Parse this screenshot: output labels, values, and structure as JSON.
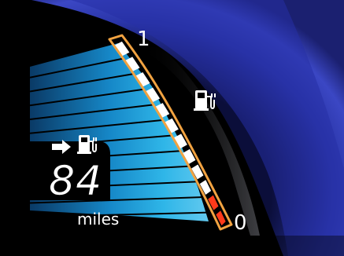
{
  "gauge": {
    "scale_max_label": "1",
    "scale_min_label": "0",
    "segments_total": 12,
    "segments_depleted": 2,
    "colors": {
      "frame": "#f2a341",
      "segment": "#ffffff",
      "segment_depleted": "#ff3a1a",
      "fill_cyan": "#1aa0dc",
      "arc_blue": "#2a35a8"
    },
    "charge_icon": "ev-charger-icon"
  },
  "range": {
    "value": "84",
    "unit": "miles",
    "indicator_icon": "arrow-right-icon",
    "station_icon": "ev-charger-icon"
  }
}
